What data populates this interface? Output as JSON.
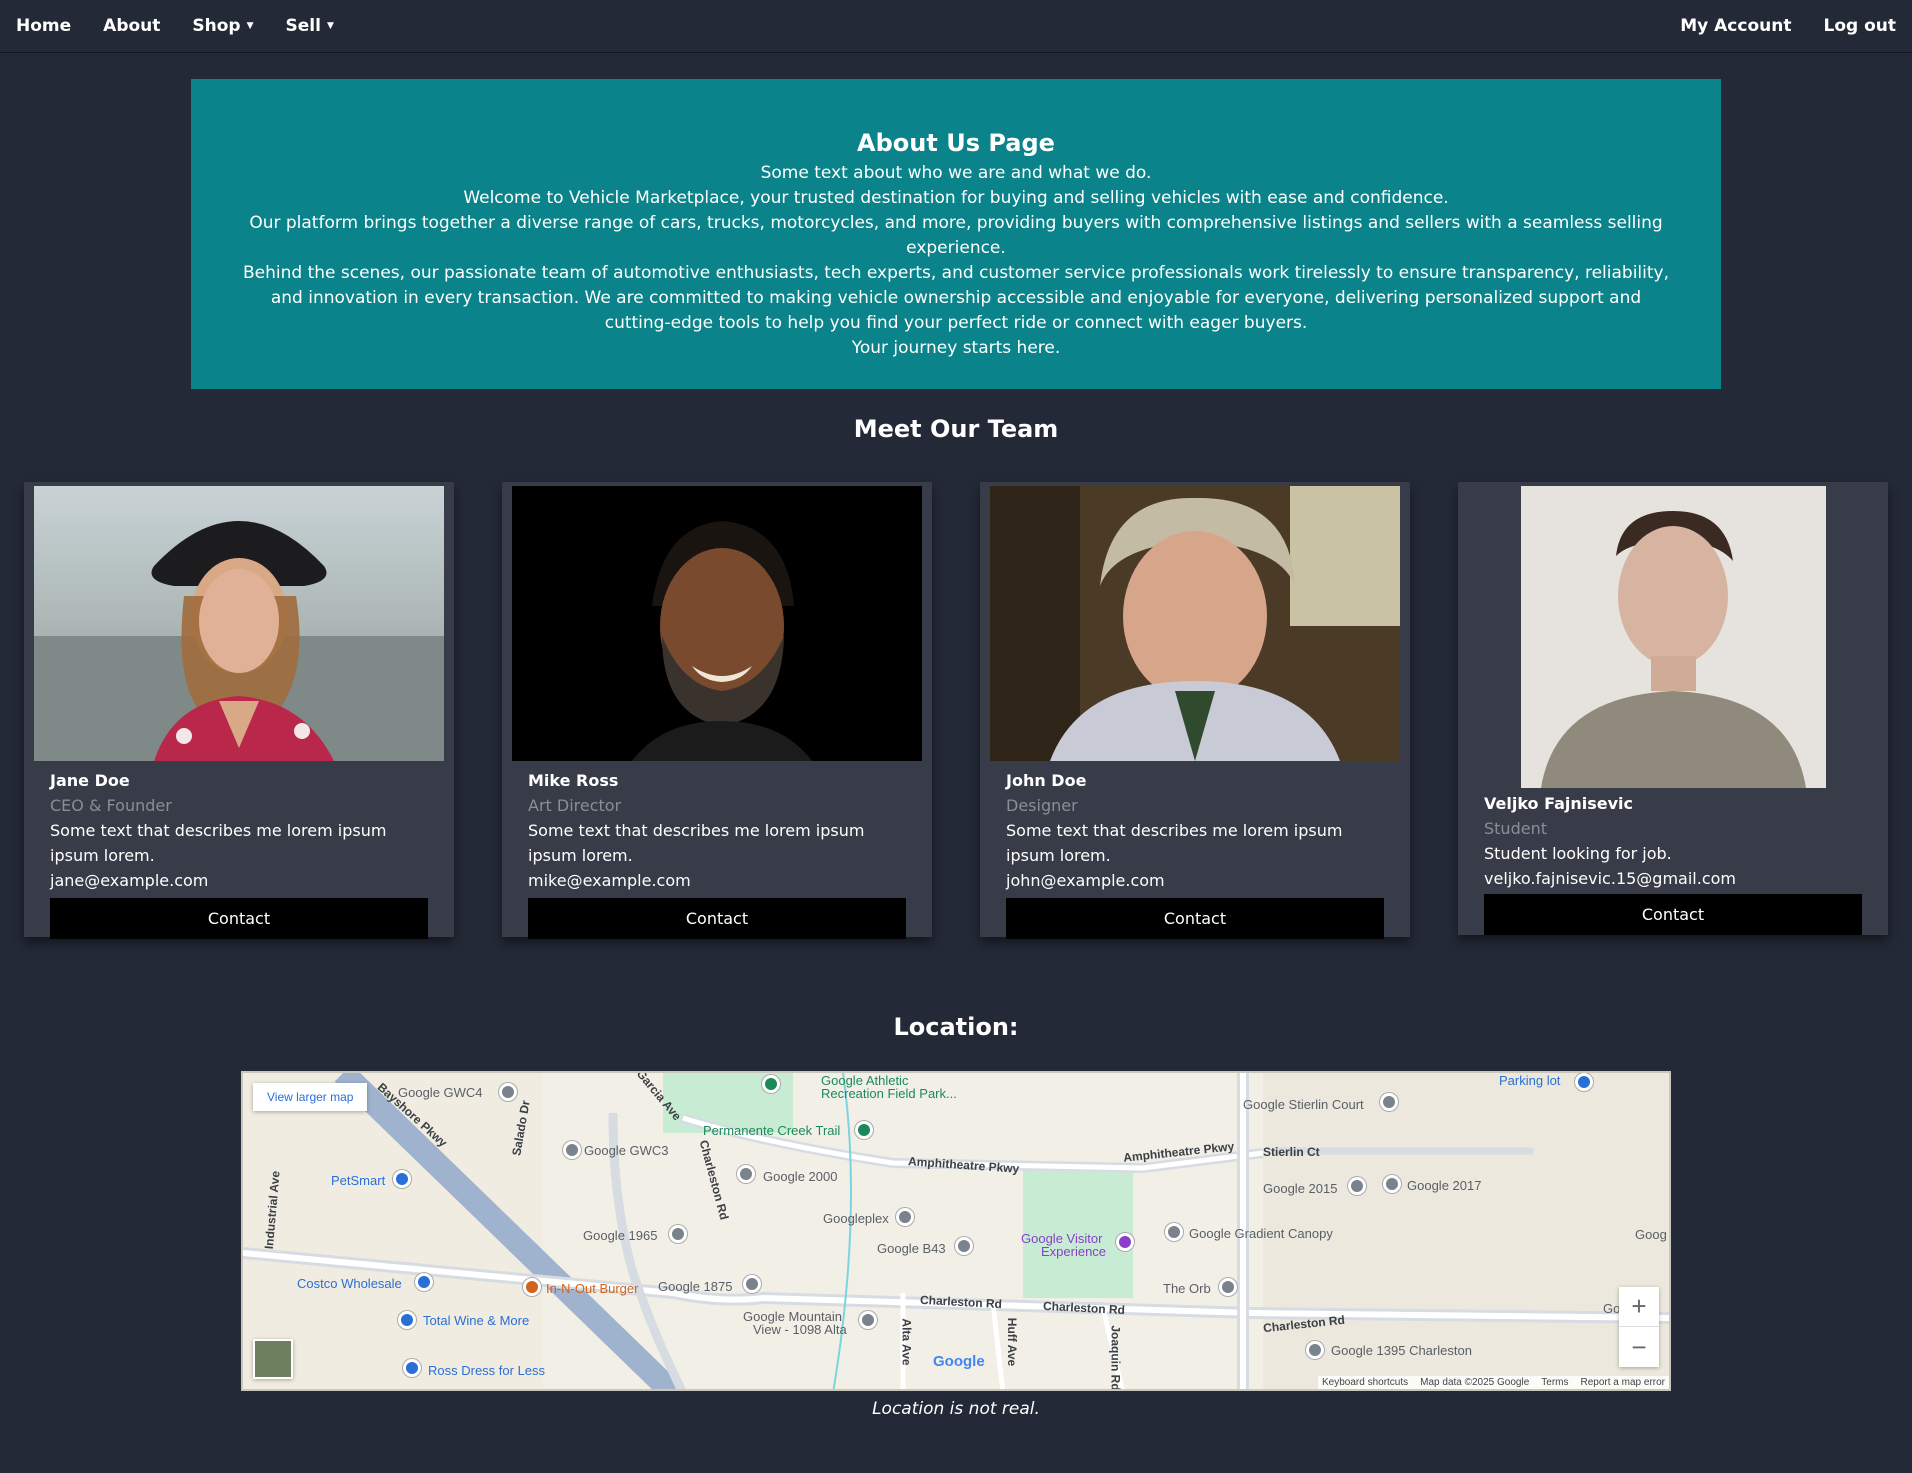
{
  "nav": {
    "home": "Home",
    "about": "About",
    "shop": "Shop",
    "sell": "Sell",
    "account": "My Account",
    "logout": "Log out"
  },
  "hero": {
    "title": "About Us Page",
    "subtitle": "Some text about who we are and what we do.",
    "welcome": "Welcome to Vehicle Marketplace, your trusted destination for buying and selling vehicles with ease and confidence.",
    "platform": "Our platform brings together a diverse range of cars, trucks, motorcycles, and more, providing buyers with comprehensive listings and sellers with a seamless selling experience.",
    "behind": "Behind the scenes, our passionate team of automotive enthusiasts, tech experts, and customer service professionals work tirelessly to ensure transparency, reliability, and innovation in every transaction. We are committed to making vehicle ownership accessible and enjoyable for everyone, delivering personalized support and cutting-edge tools to help you find your perfect ride or connect with eager buyers.",
    "journey": "Your journey starts here."
  },
  "team": {
    "title": "Meet Our Team",
    "members": [
      {
        "name": "Jane Doe",
        "role": "CEO & Founder",
        "desc": "Some text that describes me lorem ipsum ipsum lorem.",
        "email": "jane@example.com",
        "button": "Contact"
      },
      {
        "name": "Mike Ross",
        "role": "Art Director",
        "desc": "Some text that describes me lorem ipsum ipsum lorem.",
        "email": "mike@example.com",
        "button": "Contact"
      },
      {
        "name": "John Doe",
        "role": "Designer",
        "desc": "Some text that describes me lorem ipsum ipsum lorem.",
        "email": "john@example.com",
        "button": "Contact"
      },
      {
        "name": "Veljko Fajnisevic",
        "role": "Student",
        "desc": "Student looking for job.",
        "email": "veljko.fajnisevic.15@gmail.com",
        "button": "Contact"
      }
    ]
  },
  "location": {
    "title": "Location:",
    "caption": "Location is not real.",
    "map": {
      "larger_map": "View larger map",
      "zoom_in": "+",
      "zoom_out": "−",
      "google": "Google",
      "keyboard": "Keyboard shortcuts",
      "map_data": "Map data ©2025 Google",
      "terms": "Terms",
      "report": "Report a map error",
      "labels": {
        "gwc4": "Google GWC4",
        "bayshore": "Bayshore Pkwy",
        "salado": "Salado Dr",
        "garcia": "Garcia Ave",
        "athletic": "Google Athletic",
        "athletic2": "Recreation Field Park...",
        "permanente": "Permanente Creek Trail",
        "stierlin_court": "Google Stierlin Court",
        "parking": "Parking lot",
        "gwc3": "Google GWC3",
        "charleston_v": "Charleston Rd",
        "amphi1": "Amphitheatre Pkwy",
        "amphi2": "Amphitheatre Pkwy",
        "stierlin_ct": "Stierlin Ct",
        "industrial": "Industrial Ave",
        "petsmart": "PetSmart",
        "g2000": "Google 2000",
        "g2015": "Google 2015",
        "g2017": "Google 2017",
        "googleplex": "Googleplex",
        "g1965": "Google 1965",
        "gb43": "Google B43",
        "visitor": "Google Visitor",
        "visitor2": "Experience",
        "gradient": "Google Gradient Canopy",
        "goog": "Goog",
        "costco": "Costco Wholesale",
        "innout": "In-N-Out Burger",
        "g1875": "Google 1875",
        "theorb": "The Orb",
        "charleston1": "Charleston Rd",
        "charleston2": "Charleston Rd",
        "charleston3": "Charleston Rd",
        "totalwine": "Total Wine & More",
        "mountain": "Google Mountain",
        "mountain2": "View - 1098 Alta",
        "alta": "Alta Ave",
        "huff": "Huff Ave",
        "joaquin": "Joaquin Rd",
        "g1395": "Google 1395 Charleston",
        "ross": "Ross Dress for Less",
        "go": "Go"
      }
    }
  },
  "colors": {
    "background": "#232936",
    "hero": "#0a838a",
    "card": "#383c48",
    "button": "#000000"
  }
}
